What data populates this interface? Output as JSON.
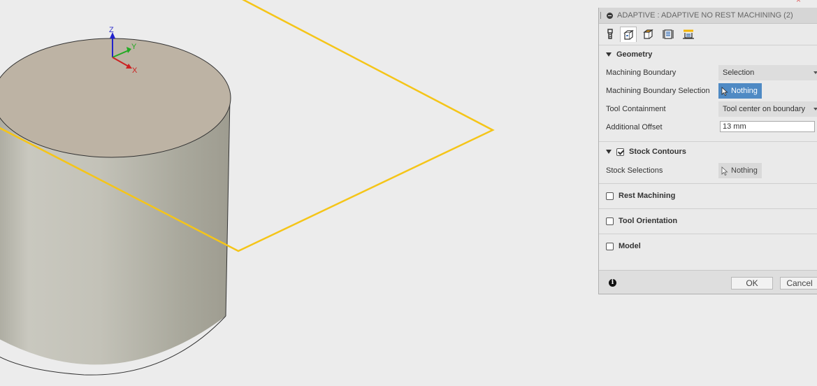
{
  "viewport": {
    "axes": {
      "z_label": "Z",
      "y_label": "Y",
      "x_label": "X"
    },
    "colors": {
      "boundary": "#f5c518",
      "cylinder_top": "#bdb3a4"
    }
  },
  "panel": {
    "title": "ADAPTIVE : ADAPTIVE NO REST MACHINING (2)",
    "tabs": [
      {
        "icon": "tool-icon"
      },
      {
        "icon": "geometry-icon"
      },
      {
        "icon": "heights-icon"
      },
      {
        "icon": "passes-icon"
      },
      {
        "icon": "linking-icon"
      }
    ],
    "geometry": {
      "heading": "Geometry",
      "machining_boundary_label": "Machining Boundary",
      "machining_boundary_value": "Selection",
      "boundary_selection_label": "Machining Boundary Selection",
      "boundary_selection_value": "Nothing",
      "tool_containment_label": "Tool Containment",
      "tool_containment_value": "Tool center on boundary",
      "additional_offset_label": "Additional Offset",
      "additional_offset_value": "13 mm"
    },
    "stock_contours": {
      "heading": "Stock Contours",
      "checked": true,
      "stock_selections_label": "Stock Selections",
      "stock_selections_value": "Nothing"
    },
    "rest_machining": {
      "heading": "Rest Machining",
      "checked": false
    },
    "tool_orientation": {
      "heading": "Tool Orientation",
      "checked": false
    },
    "model": {
      "heading": "Model",
      "checked": false
    },
    "footer": {
      "ok_label": "OK",
      "cancel_label": "Cancel"
    }
  }
}
